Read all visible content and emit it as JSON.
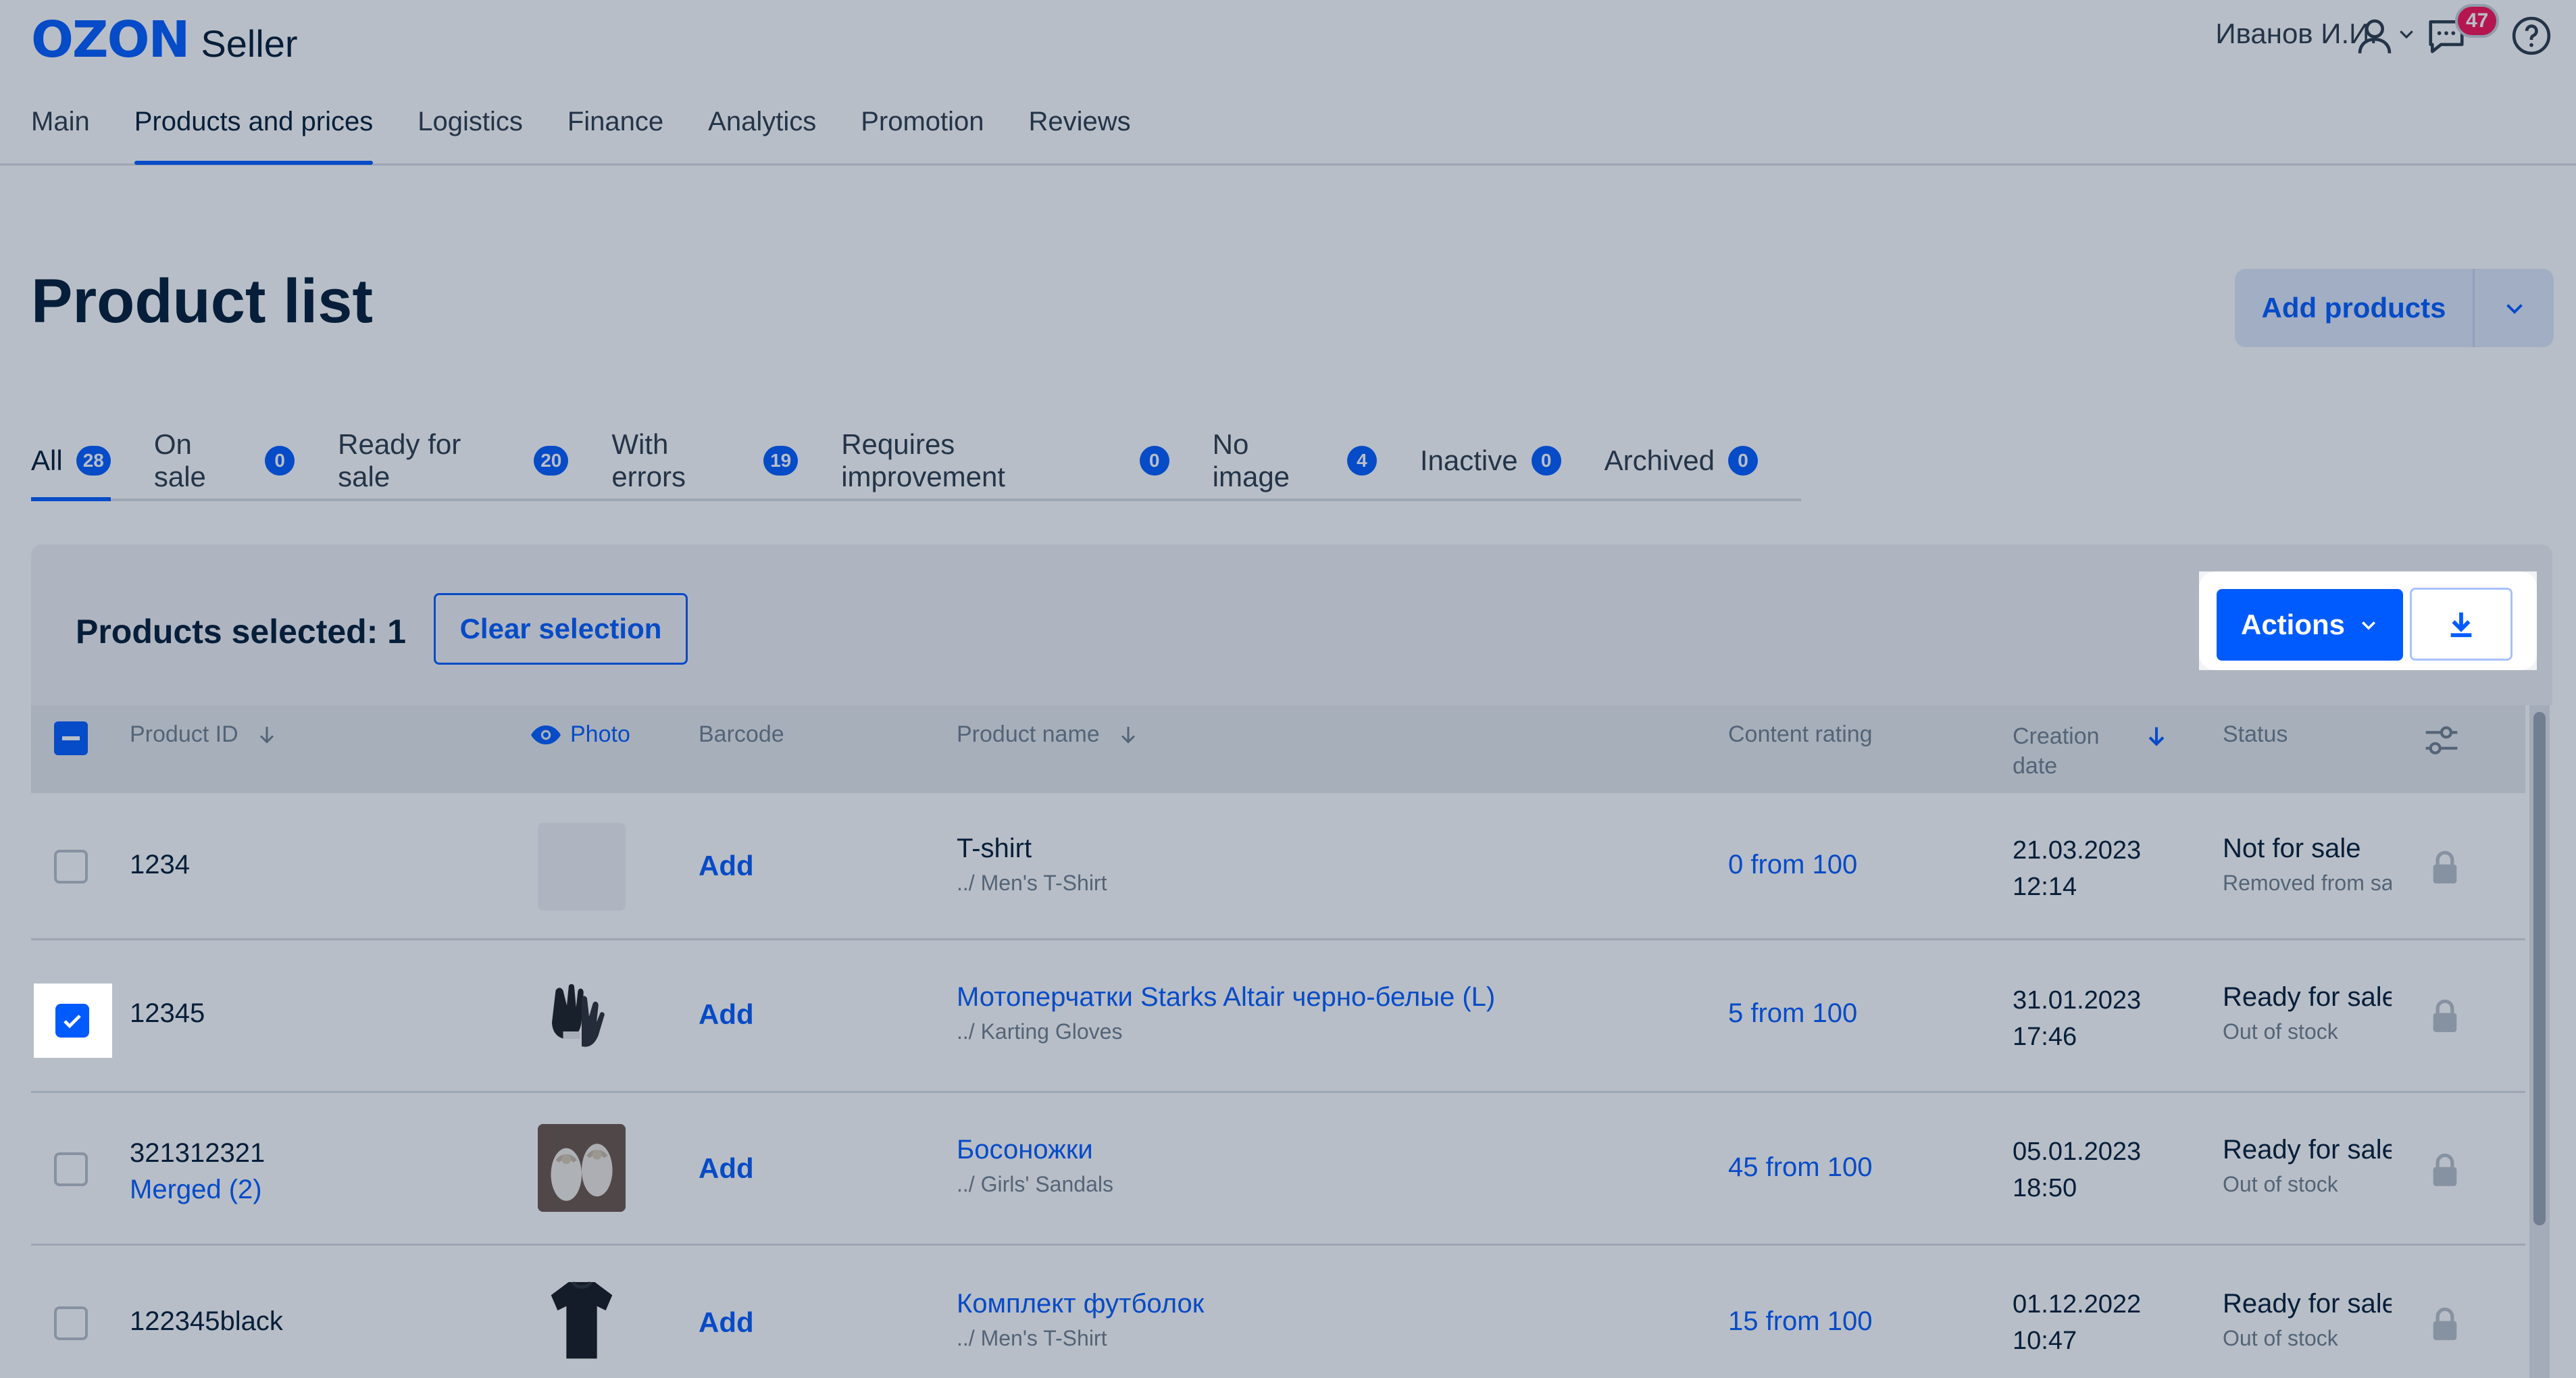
{
  "header": {
    "logo": "OZON",
    "logo_suffix": "Seller",
    "user_name": "Иванов И.И.",
    "notifications_count": "47",
    "nav": [
      "Main",
      "Products and prices",
      "Logistics",
      "Finance",
      "Analytics",
      "Promotion",
      "Reviews"
    ],
    "nav_active": "Products and prices",
    "icons": [
      "user-icon",
      "chat-icon",
      "help-icon"
    ]
  },
  "page": {
    "title": "Product list",
    "add_products": "Add products"
  },
  "tabs": [
    {
      "label": "All",
      "count": "28"
    },
    {
      "label": "On sale",
      "count": "0"
    },
    {
      "label": "Ready for sale",
      "count": "20"
    },
    {
      "label": "With errors",
      "count": "19"
    },
    {
      "label": "Requires improvement",
      "count": "0"
    },
    {
      "label": "No image",
      "count": "4"
    },
    {
      "label": "Inactive",
      "count": "0"
    },
    {
      "label": "Archived",
      "count": "0"
    }
  ],
  "selection": {
    "text": "Products selected: 1",
    "clear": "Clear selection",
    "actions": "Actions"
  },
  "columns": {
    "product_id": "Product ID",
    "photo": "Photo",
    "barcode": "Barcode",
    "product_name": "Product name",
    "content_rating": "Content rating",
    "creation_date_1": "Creation",
    "creation_date_2": "date",
    "status": "Status"
  },
  "rows": [
    {
      "id": "1234",
      "merged": "",
      "barcode": "Add",
      "name": "T-shirt",
      "category": "../ Men's T-Shirt",
      "rating": "0 from 100",
      "date": "21.03.2023",
      "time": "12:14",
      "status": "Not for sale",
      "status_sub": "Removed from sale",
      "checked": false,
      "photo": "empty"
    },
    {
      "id": "12345",
      "merged": "",
      "barcode": "Add",
      "name": "Мотоперчатки Starks Altair черно-белые (L)",
      "category": "../ Karting Gloves",
      "rating": "5 from 100",
      "date": "31.01.2023",
      "time": "17:46",
      "status": "Ready for sale",
      "status_sub": "Out of stock",
      "checked": true,
      "photo": "gloves"
    },
    {
      "id": "321312321",
      "merged": "Merged (2)",
      "barcode": "Add",
      "name": "Босоножки",
      "category": "../ Girls' Sandals",
      "rating": "45 from 100",
      "date": "05.01.2023",
      "time": "18:50",
      "status": "Ready for sale",
      "status_sub": "Out of stock",
      "checked": false,
      "photo": "sandals"
    },
    {
      "id": "122345black",
      "merged": "",
      "barcode": "Add",
      "name": "Комплект футболок",
      "category": "../ Men's T-Shirt",
      "rating": "15 from 100",
      "date": "01.12.2022",
      "time": "10:47",
      "status": "Ready for sale",
      "status_sub": "Out of stock",
      "checked": false,
      "photo": "tshirt"
    }
  ]
}
